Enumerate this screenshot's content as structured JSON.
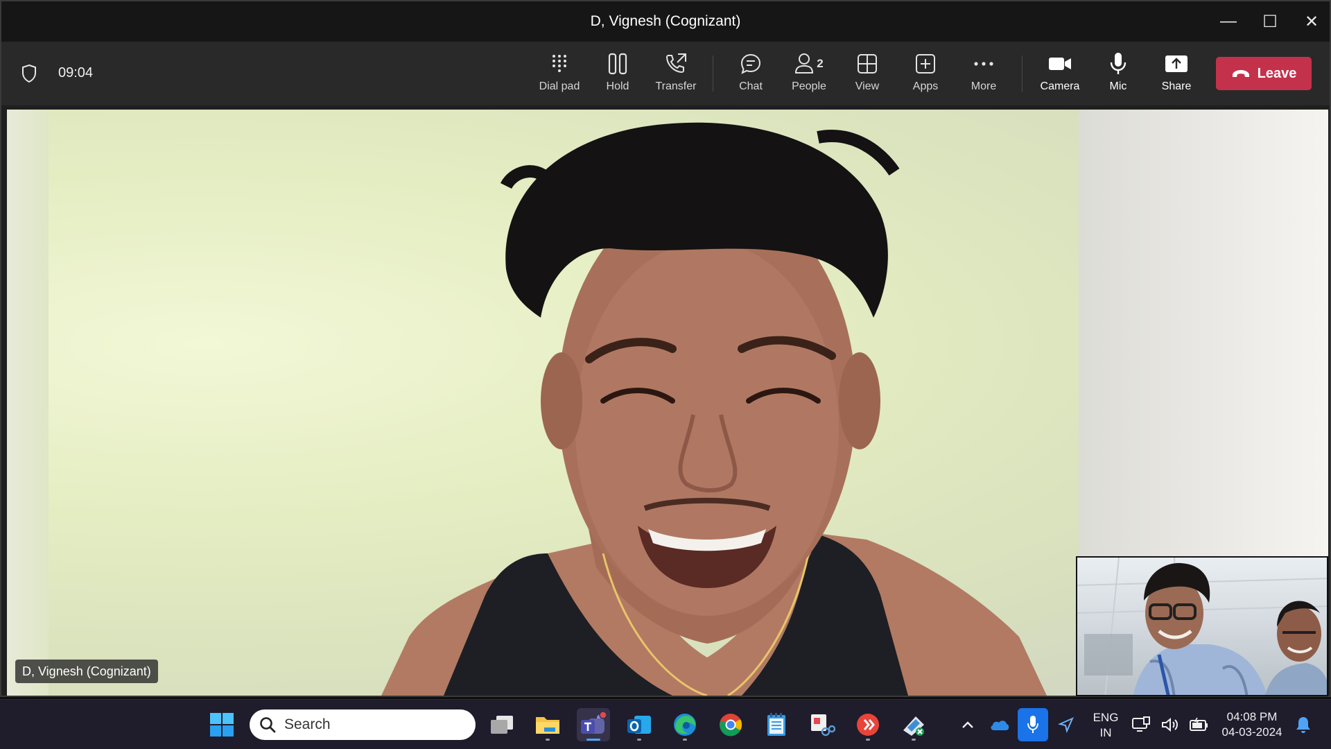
{
  "window": {
    "title": "D, Vignesh (Cognizant)",
    "minimize_glyph": "—",
    "maximize_glyph": "☐",
    "close_glyph": "✕"
  },
  "call": {
    "timer": "09:04",
    "tools": [
      {
        "label": "Dial pad",
        "icon": "dial-pad-icon"
      },
      {
        "label": "Hold",
        "icon": "hold-icon"
      },
      {
        "label": "Transfer",
        "icon": "transfer-icon"
      },
      {
        "label": "Chat",
        "icon": "chat-icon"
      },
      {
        "label": "People",
        "icon": "people-icon",
        "badge": "2"
      },
      {
        "label": "View",
        "icon": "view-icon"
      },
      {
        "label": "Apps",
        "icon": "apps-icon"
      },
      {
        "label": "More",
        "icon": "more-icon"
      },
      {
        "label": "Camera",
        "icon": "camera-icon"
      },
      {
        "label": "Mic",
        "icon": "mic-icon"
      },
      {
        "label": "Share",
        "icon": "share-icon"
      }
    ],
    "leave_label": "Leave",
    "leave_color": "#c4314b"
  },
  "video": {
    "participant_name": "D, Vignesh (Cognizant)"
  },
  "taskbar": {
    "search_placeholder": "Search",
    "language_top": "ENG",
    "language_bottom": "IN",
    "time": "04:08 PM",
    "date": "04-03-2024"
  }
}
